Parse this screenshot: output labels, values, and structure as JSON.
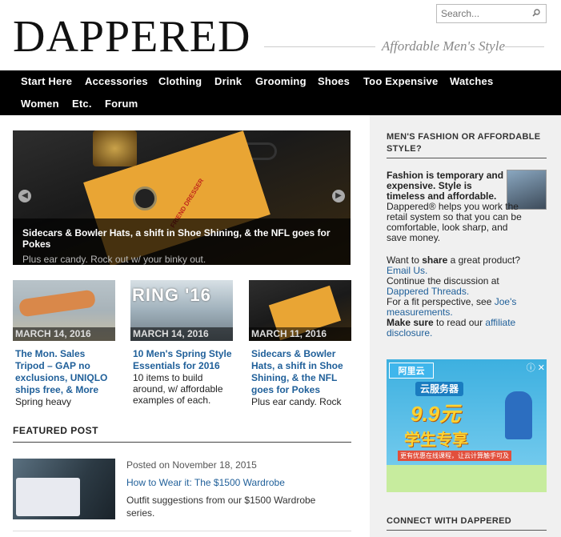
{
  "header": {
    "logo": "DAPPERED",
    "tagline": "Affordable Men's Style",
    "search_placeholder": "Search..."
  },
  "nav": {
    "items": [
      "Start Here",
      "Accessories",
      "Clothing",
      "Drink",
      "Grooming",
      "Shoes",
      "Too Expensive",
      "Watches",
      "Women",
      "Etc.",
      "Forum"
    ]
  },
  "slider": {
    "title": "Sidecars & Bowler Hats, a shift in Shoe Shining, & the NFL goes for Pokes",
    "subtitle": "Plus ear candy. Rock out w/ your binky out.",
    "envelope_text": "FRIEND DRESSER"
  },
  "cards": [
    {
      "date": "MARCH 14, 2016",
      "title": "The Mon. Sales Tripod – GAP no exclusions, UNIQLO ships free, & More",
      "excerpt": "Spring heavy"
    },
    {
      "date": "MARCH 14, 2016",
      "title": "10 Men's Spring Style Essentials for 2016",
      "excerpt": "10 items to build around, w/ affordable examples of each.",
      "thumb_text": "RING '16"
    },
    {
      "date": "MARCH 11, 2016",
      "title": "Sidecars & Bowler Hats, a shift in Shoe Shining, & the NFL goes for Pokes",
      "excerpt": "Plus ear candy. Rock"
    }
  ],
  "featured": {
    "heading": "FEATURED POST",
    "posted": "Posted on November 18, 2015",
    "title": "How to Wear it: The $1500 Wardrobe",
    "excerpt": "Outfit suggestions from our $1500 Wardrobe series."
  },
  "sidebar": {
    "heading1": "MEN'S FASHION OR AFFORDABLE STYLE?",
    "intro_bold": "Fashion is temporary and expensive. Style is timeless and affordable.",
    "intro_rest": "Dappered® helps you work the retail system so that you can be comfortable, look sharp, and save money.",
    "share_pre": "Want to ",
    "share_bold": "share",
    "share_post": " a great product?",
    "email_link": "Email Us.",
    "continue": "Continue the discussion at",
    "threads_link": "Dappered Threads.",
    "fit_pre": "For a fit perspective, see ",
    "fit_link": "Joe's measurements.",
    "make_sure": "Make sure",
    "read_our": " to read our ",
    "disclosure_link": "affiliate disclosure.",
    "heading2": "CONNECT WITH DAPPERED"
  },
  "ad": {
    "brand": "阿里云",
    "brand_sub": "aliyun.com",
    "line1": "云服务器",
    "line2": "9.9元",
    "line3": "学生专享",
    "line4": "更有优惠在线课程，让云计算触手可及"
  },
  "colors": {
    "link": "#1f5f99",
    "nav_bg": "#000000",
    "sidebar_bg": "#f0f0f0"
  }
}
